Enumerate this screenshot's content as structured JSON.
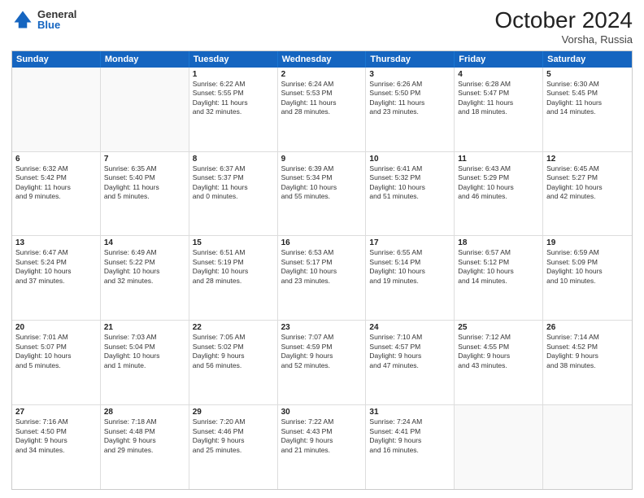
{
  "header": {
    "logo_general": "General",
    "logo_blue": "Blue",
    "month_title": "October 2024",
    "location": "Vorsha, Russia"
  },
  "weekdays": [
    "Sunday",
    "Monday",
    "Tuesday",
    "Wednesday",
    "Thursday",
    "Friday",
    "Saturday"
  ],
  "rows": [
    [
      {
        "day": "",
        "lines": [],
        "empty": true
      },
      {
        "day": "",
        "lines": [],
        "empty": true
      },
      {
        "day": "1",
        "lines": [
          "Sunrise: 6:22 AM",
          "Sunset: 5:55 PM",
          "Daylight: 11 hours",
          "and 32 minutes."
        ]
      },
      {
        "day": "2",
        "lines": [
          "Sunrise: 6:24 AM",
          "Sunset: 5:53 PM",
          "Daylight: 11 hours",
          "and 28 minutes."
        ]
      },
      {
        "day": "3",
        "lines": [
          "Sunrise: 6:26 AM",
          "Sunset: 5:50 PM",
          "Daylight: 11 hours",
          "and 23 minutes."
        ]
      },
      {
        "day": "4",
        "lines": [
          "Sunrise: 6:28 AM",
          "Sunset: 5:47 PM",
          "Daylight: 11 hours",
          "and 18 minutes."
        ]
      },
      {
        "day": "5",
        "lines": [
          "Sunrise: 6:30 AM",
          "Sunset: 5:45 PM",
          "Daylight: 11 hours",
          "and 14 minutes."
        ]
      }
    ],
    [
      {
        "day": "6",
        "lines": [
          "Sunrise: 6:32 AM",
          "Sunset: 5:42 PM",
          "Daylight: 11 hours",
          "and 9 minutes."
        ]
      },
      {
        "day": "7",
        "lines": [
          "Sunrise: 6:35 AM",
          "Sunset: 5:40 PM",
          "Daylight: 11 hours",
          "and 5 minutes."
        ]
      },
      {
        "day": "8",
        "lines": [
          "Sunrise: 6:37 AM",
          "Sunset: 5:37 PM",
          "Daylight: 11 hours",
          "and 0 minutes."
        ]
      },
      {
        "day": "9",
        "lines": [
          "Sunrise: 6:39 AM",
          "Sunset: 5:34 PM",
          "Daylight: 10 hours",
          "and 55 minutes."
        ]
      },
      {
        "day": "10",
        "lines": [
          "Sunrise: 6:41 AM",
          "Sunset: 5:32 PM",
          "Daylight: 10 hours",
          "and 51 minutes."
        ]
      },
      {
        "day": "11",
        "lines": [
          "Sunrise: 6:43 AM",
          "Sunset: 5:29 PM",
          "Daylight: 10 hours",
          "and 46 minutes."
        ]
      },
      {
        "day": "12",
        "lines": [
          "Sunrise: 6:45 AM",
          "Sunset: 5:27 PM",
          "Daylight: 10 hours",
          "and 42 minutes."
        ]
      }
    ],
    [
      {
        "day": "13",
        "lines": [
          "Sunrise: 6:47 AM",
          "Sunset: 5:24 PM",
          "Daylight: 10 hours",
          "and 37 minutes."
        ]
      },
      {
        "day": "14",
        "lines": [
          "Sunrise: 6:49 AM",
          "Sunset: 5:22 PM",
          "Daylight: 10 hours",
          "and 32 minutes."
        ]
      },
      {
        "day": "15",
        "lines": [
          "Sunrise: 6:51 AM",
          "Sunset: 5:19 PM",
          "Daylight: 10 hours",
          "and 28 minutes."
        ]
      },
      {
        "day": "16",
        "lines": [
          "Sunrise: 6:53 AM",
          "Sunset: 5:17 PM",
          "Daylight: 10 hours",
          "and 23 minutes."
        ]
      },
      {
        "day": "17",
        "lines": [
          "Sunrise: 6:55 AM",
          "Sunset: 5:14 PM",
          "Daylight: 10 hours",
          "and 19 minutes."
        ]
      },
      {
        "day": "18",
        "lines": [
          "Sunrise: 6:57 AM",
          "Sunset: 5:12 PM",
          "Daylight: 10 hours",
          "and 14 minutes."
        ]
      },
      {
        "day": "19",
        "lines": [
          "Sunrise: 6:59 AM",
          "Sunset: 5:09 PM",
          "Daylight: 10 hours",
          "and 10 minutes."
        ]
      }
    ],
    [
      {
        "day": "20",
        "lines": [
          "Sunrise: 7:01 AM",
          "Sunset: 5:07 PM",
          "Daylight: 10 hours",
          "and 5 minutes."
        ]
      },
      {
        "day": "21",
        "lines": [
          "Sunrise: 7:03 AM",
          "Sunset: 5:04 PM",
          "Daylight: 10 hours",
          "and 1 minute."
        ]
      },
      {
        "day": "22",
        "lines": [
          "Sunrise: 7:05 AM",
          "Sunset: 5:02 PM",
          "Daylight: 9 hours",
          "and 56 minutes."
        ]
      },
      {
        "day": "23",
        "lines": [
          "Sunrise: 7:07 AM",
          "Sunset: 4:59 PM",
          "Daylight: 9 hours",
          "and 52 minutes."
        ]
      },
      {
        "day": "24",
        "lines": [
          "Sunrise: 7:10 AM",
          "Sunset: 4:57 PM",
          "Daylight: 9 hours",
          "and 47 minutes."
        ]
      },
      {
        "day": "25",
        "lines": [
          "Sunrise: 7:12 AM",
          "Sunset: 4:55 PM",
          "Daylight: 9 hours",
          "and 43 minutes."
        ]
      },
      {
        "day": "26",
        "lines": [
          "Sunrise: 7:14 AM",
          "Sunset: 4:52 PM",
          "Daylight: 9 hours",
          "and 38 minutes."
        ]
      }
    ],
    [
      {
        "day": "27",
        "lines": [
          "Sunrise: 7:16 AM",
          "Sunset: 4:50 PM",
          "Daylight: 9 hours",
          "and 34 minutes."
        ]
      },
      {
        "day": "28",
        "lines": [
          "Sunrise: 7:18 AM",
          "Sunset: 4:48 PM",
          "Daylight: 9 hours",
          "and 29 minutes."
        ]
      },
      {
        "day": "29",
        "lines": [
          "Sunrise: 7:20 AM",
          "Sunset: 4:46 PM",
          "Daylight: 9 hours",
          "and 25 minutes."
        ]
      },
      {
        "day": "30",
        "lines": [
          "Sunrise: 7:22 AM",
          "Sunset: 4:43 PM",
          "Daylight: 9 hours",
          "and 21 minutes."
        ]
      },
      {
        "day": "31",
        "lines": [
          "Sunrise: 7:24 AM",
          "Sunset: 4:41 PM",
          "Daylight: 9 hours",
          "and 16 minutes."
        ]
      },
      {
        "day": "",
        "lines": [],
        "empty": true
      },
      {
        "day": "",
        "lines": [],
        "empty": true
      }
    ]
  ]
}
